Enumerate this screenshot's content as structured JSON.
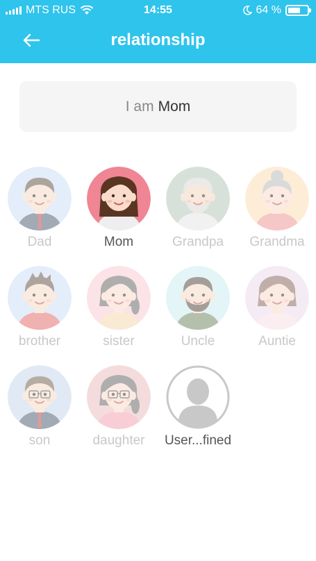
{
  "status_bar": {
    "carrier": "MTS RUS",
    "time": "14:55",
    "battery": "64 %",
    "battery_level": 0.64
  },
  "header": {
    "title": "relationship",
    "back_icon": "back-arrow-icon"
  },
  "selection": {
    "prefix": "I am",
    "value": "Mom"
  },
  "colors": {
    "accent": "#2fc4ec",
    "selected_label": "#555555",
    "label": "#c8c8c8"
  },
  "relations": [
    {
      "label": "Dad",
      "bg": "#cfe0f6",
      "selected": false
    },
    {
      "label": "Mom",
      "bg": "#f08593",
      "selected": true
    },
    {
      "label": "Grandpa",
      "bg": "#b7c9bb",
      "selected": false
    },
    {
      "label": "Grandma",
      "bg": "#fde0b8",
      "selected": false
    },
    {
      "label": "brother",
      "bg": "#cfe0f6",
      "selected": false
    },
    {
      "label": "sister",
      "bg": "#f8cdd5",
      "selected": false
    },
    {
      "label": "Uncle",
      "bg": "#cdeef0",
      "selected": false
    },
    {
      "label": "Auntie",
      "bg": "#ecdcec",
      "selected": false
    },
    {
      "label": "son",
      "bg": "#c9d9ec",
      "selected": false
    },
    {
      "label": "daughter",
      "bg": "#ecc1c1",
      "selected": false
    },
    {
      "label": "User...fined",
      "bg": "#ffffff",
      "selected": false
    }
  ]
}
